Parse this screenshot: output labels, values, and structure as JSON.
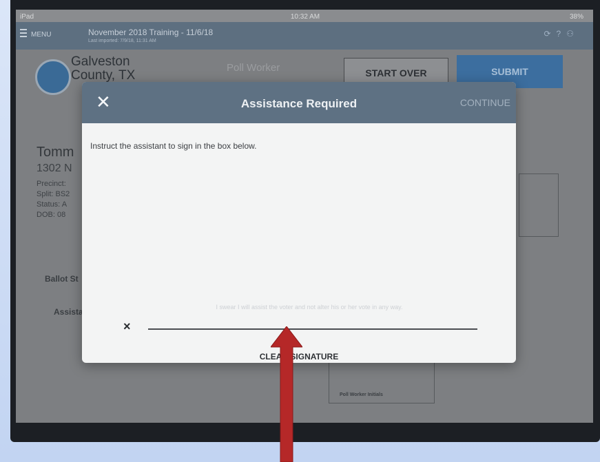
{
  "status_bar": {
    "device": "iPad",
    "time": "10:32 AM",
    "battery": "38%"
  },
  "app_nav": {
    "menu_label": "MENU",
    "title": "November 2018 Training - 11/6/18",
    "subtitle": "Last imported: 7/9/18, 11:31 AM"
  },
  "header": {
    "county_line1": "Galveston",
    "county_line2": "County, TX",
    "poll_worker": "Poll Worker",
    "start_over": "START OVER",
    "submit": "SUBMIT"
  },
  "voter": {
    "name": "Tomm",
    "address": "1302 N",
    "precinct": "Precinct:",
    "split": "Split: BS2",
    "status": "Status: A",
    "dob": "DOB: 08"
  },
  "sections": {
    "ballot_style": "Ballot St",
    "assistance": "Assistan",
    "poll_worker_initials": "Poll Worker Initials"
  },
  "modal": {
    "close_icon": "close-icon",
    "title": "Assistance Required",
    "continue": "CONTINUE",
    "instruction": "Instruct the assistant to sign in the box below.",
    "oath": "I swear I will assist the voter and not alter his or her vote in any way.",
    "signature_mark": "×",
    "clear_signature": "CLEAR SIGNATURE"
  },
  "colors": {
    "modal_header": "#5e7183",
    "submit": "#3c6e9f",
    "arrow": "#b52828",
    "slide_bg": "#c9d9f3"
  }
}
